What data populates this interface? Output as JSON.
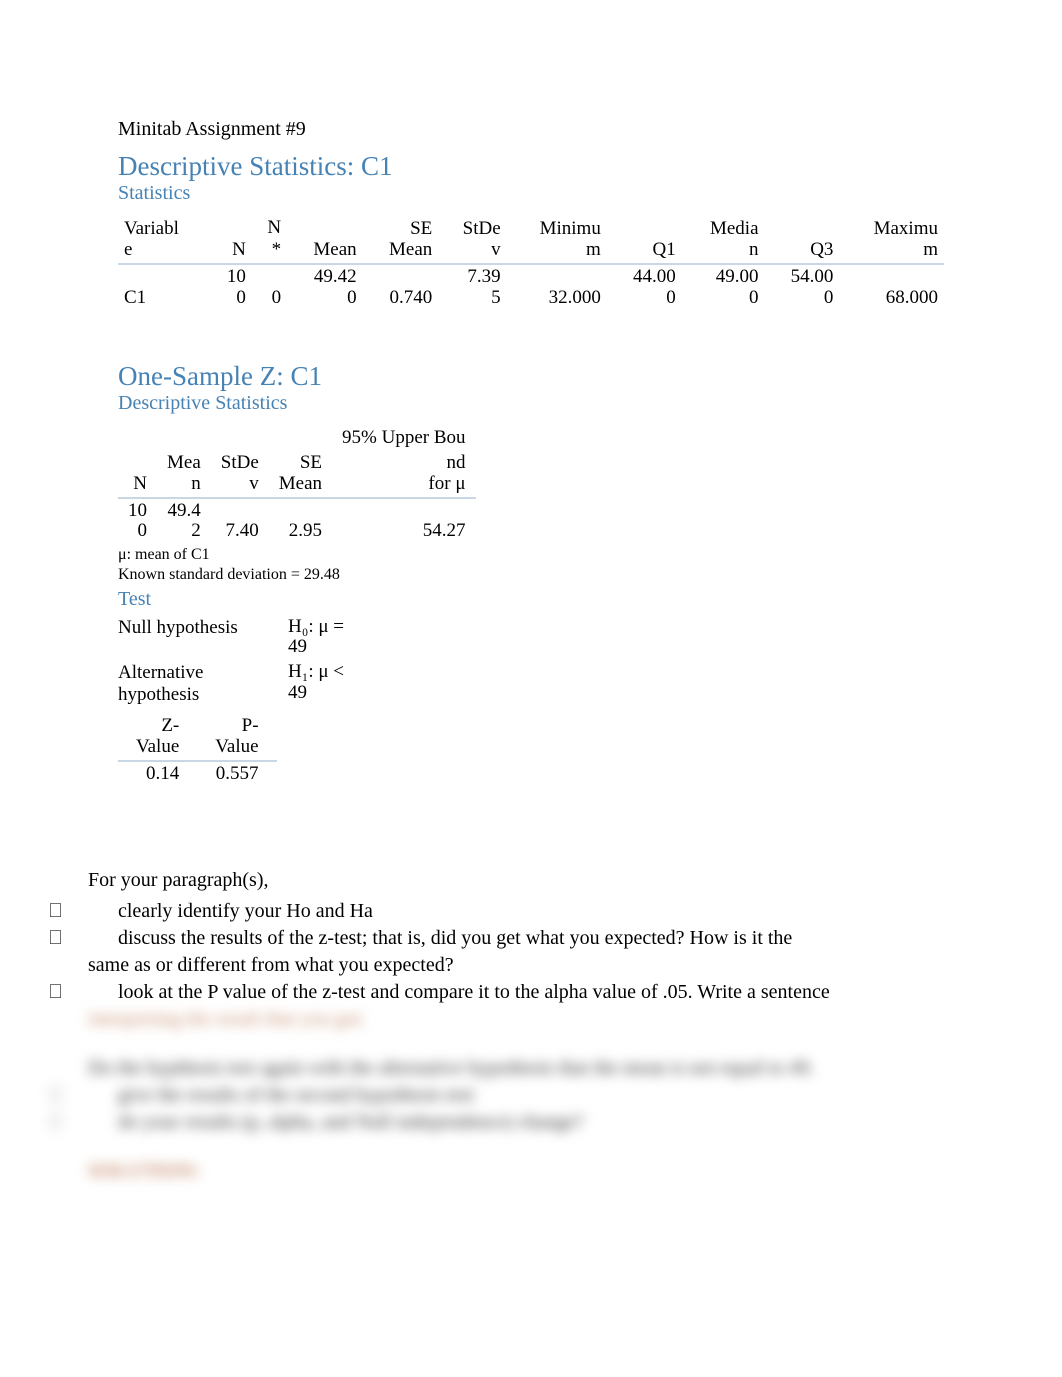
{
  "doc_title": "Minitab Assignment #9",
  "sec1_title": "Descriptive Statistics: C1",
  "sec1_sub": "Statistics",
  "stats_headers": {
    "variable": "Variable",
    "n": "N",
    "nstar": "N*",
    "mean": "Mean",
    "semean": "SE Mean",
    "stdev": "StDev",
    "min": "Minimum",
    "q1": "Q1",
    "median": "Median",
    "q3": "Q3",
    "max": "Maximum"
  },
  "stats_row": {
    "variable": "C1",
    "n": "100",
    "nstar": "0",
    "mean": "49.420",
    "semean": "0.740",
    "stdev": "7.395",
    "min": "32.000",
    "q1": "44.000",
    "median": "49.000",
    "q3": "54.000",
    "max": "68.000"
  },
  "sec2_title": "One-Sample Z: C1",
  "sec2_sub": "Descriptive Statistics",
  "z_headers": {
    "n": "N",
    "mean": "Mean",
    "stdev": "StDev",
    "semean": "SE Mean",
    "ub": "95% Upper Bound for μ"
  },
  "z_row": {
    "n": "100",
    "mean": "49.42",
    "stdev": "7.40",
    "semean": "2.95",
    "ub": "54.27"
  },
  "footnote1": "μ: mean of C1",
  "footnote2": "Known standard deviation = 29.48",
  "test_title": "Test",
  "hyp_null_label": "Null hypothesis",
  "hyp_null_val": "H₀: μ = 49",
  "hyp_alt_label": "Alternative hypothesis",
  "hyp_alt_val": "H₁: μ < 49",
  "zp_headers": {
    "z": "Z-Value",
    "p": "P-Value"
  },
  "zp_row": {
    "z": "0.14",
    "p": "0.557"
  },
  "para_lead": "For your paragraph(s),",
  "bullets": [
    "clearly identify your Ho and Ha",
    "discuss the results of the z-test; that is, did you get what you expected? How is it the same as or different from what you expected?",
    "look at the P value of the z-test and compare it to the alpha value of .05. Write a sentence"
  ],
  "blurred_line1": "interpreting the result that you got.",
  "blurred_para": "Do the hypthesis test again with the alternative hypothesis that the mean is not equal to 49.",
  "blurred_b1": "give the results of the second hypothesis test",
  "blurred_b2": "do your results (p, alpha, and Null independence) change?",
  "blurred_final": "SOLUTION:"
}
